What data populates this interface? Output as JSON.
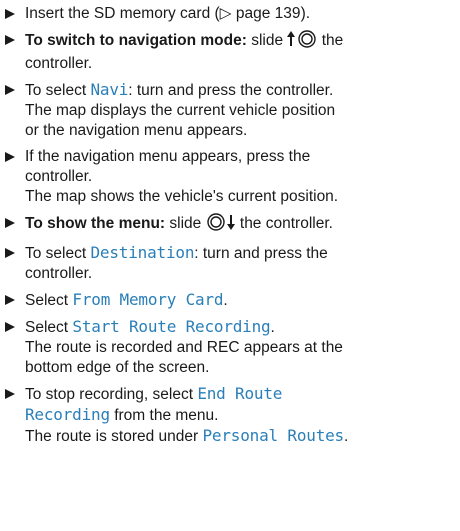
{
  "steps": [
    {
      "lines": [
        {
          "a": "Insert the SD memory card (",
          "ref": "▷ page 139",
          "b": ")."
        }
      ]
    },
    {
      "bold": "To switch to navigation mode:",
      "a": " slide ",
      "b": " the",
      "line2": "controller."
    },
    {
      "a": "To select ",
      "ui": "Navi",
      "b": ": turn and press the controller.",
      "result1": "The map displays the current vehicle position",
      "result2": "or the navigation menu appears."
    },
    {
      "line1": "If the navigation menu appears, press the",
      "line2": "controller.",
      "result": "The map shows the vehicle's current position."
    },
    {
      "bold": "To show the menu:",
      "a": " slide ",
      "b": " the controller."
    },
    {
      "a": "To select ",
      "ui": "Destination",
      "b": ": turn and press the",
      "line2": "controller."
    },
    {
      "a": "Select ",
      "ui": "From Memory Card",
      "b": "."
    },
    {
      "a": "Select ",
      "ui": "Start Route Recording",
      "b": ".",
      "result1": "The route is recorded and REC appears at the",
      "result2": "bottom edge of the screen."
    },
    {
      "a": "To stop recording, select ",
      "ui1": "End Route",
      "ui2": "Recording",
      "b": " from the menu.",
      "r_a": "The route is stored under ",
      "r_ui": "Personal Routes",
      "r_b": "."
    }
  ]
}
